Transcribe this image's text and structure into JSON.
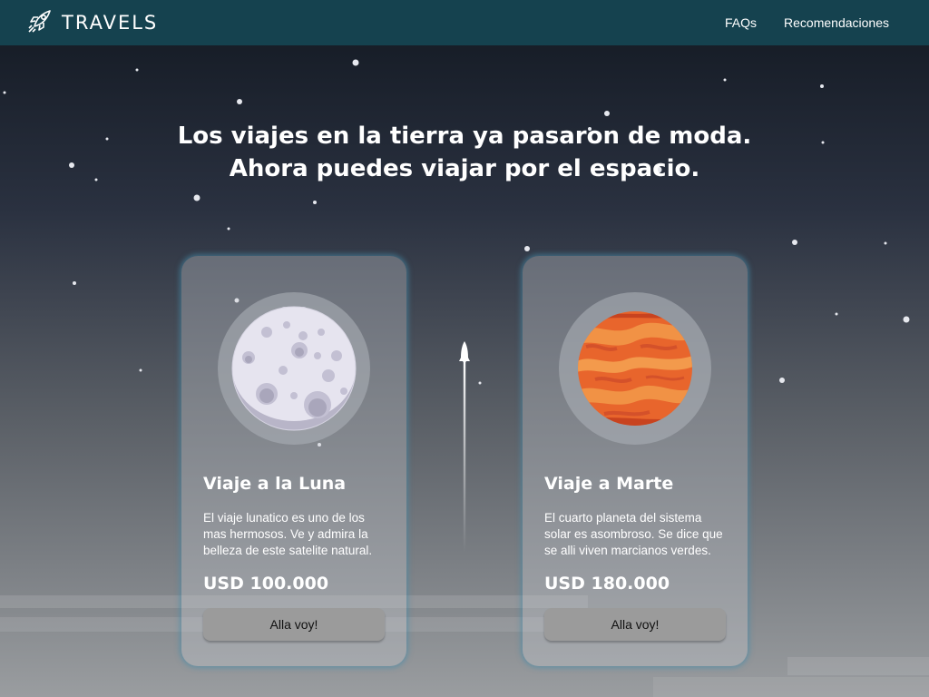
{
  "nav": {
    "brand": "TRAVELS",
    "links": [
      "FAQs",
      "Recomendaciones"
    ]
  },
  "hero": {
    "line1": "Los viajes en la tierra ya pasaron de moda.",
    "line2": "Ahora puedes viajar por el espacio."
  },
  "cards": [
    {
      "title": "Viaje a la Luna",
      "description": "El viaje lunatico es uno de los mas hermosos. Ve y admira la belleza de este satelite natural.",
      "price": "USD 100.000",
      "button": "Alla voy!"
    },
    {
      "title": "Viaje a Marte",
      "description": "El cuarto planeta del sistema solar es asombroso. Se dice que se alli viven marcianos verdes.",
      "price": "USD 180.000",
      "button": "Alla voy!"
    }
  ],
  "colors": {
    "navbar": "#15424f",
    "card_glow": "#468caa",
    "button": "#9b9b9b",
    "mars": "#e8652c",
    "moon": "#dcdae6"
  }
}
